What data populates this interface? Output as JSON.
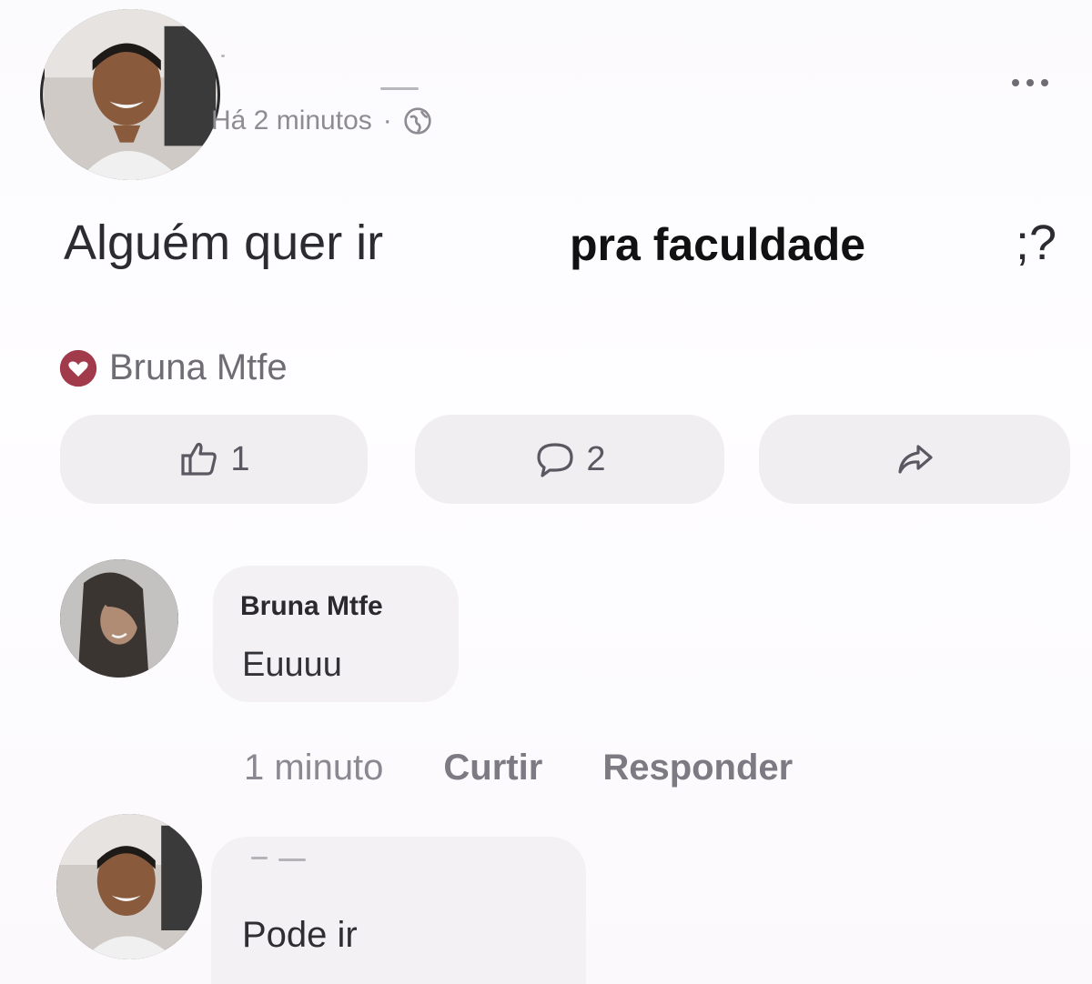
{
  "post": {
    "timestamp": "Há 2 minutos",
    "separator": "·",
    "privacy_icon": "globe-icon",
    "more_icon": "more-options-icon",
    "text_part1": "Alguém quer ir",
    "text_part2": "pra faculdade",
    "text_part3": ";?",
    "reaction_icon": "heart-icon",
    "reaction_name": "Bruna Mtfe"
  },
  "actions": {
    "like_count": "1",
    "comment_count": "2",
    "like_icon": "thumbs-up-icon",
    "comment_icon": "comment-icon",
    "share_icon": "share-icon"
  },
  "comment": {
    "author": "Bruna Mtfe",
    "text": "Euuuu",
    "time": "1 minuto",
    "like_label": "Curtir",
    "reply_label": "Responder"
  },
  "reply": {
    "text": "Pode ir"
  },
  "colors": {
    "heart": "#a13a4a",
    "bubble": "#f3f1f4",
    "button": "#f1eef2"
  }
}
